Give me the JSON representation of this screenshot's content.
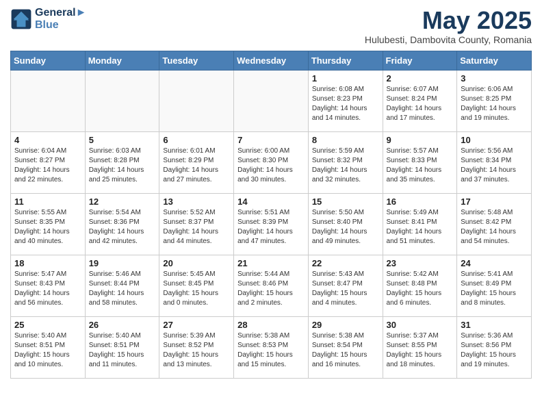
{
  "header": {
    "logo_line1": "General",
    "logo_line2": "Blue",
    "month_title": "May 2025",
    "location": "Hulubesti, Dambovita County, Romania"
  },
  "days_of_week": [
    "Sunday",
    "Monday",
    "Tuesday",
    "Wednesday",
    "Thursday",
    "Friday",
    "Saturday"
  ],
  "weeks": [
    [
      {
        "day": "",
        "info": ""
      },
      {
        "day": "",
        "info": ""
      },
      {
        "day": "",
        "info": ""
      },
      {
        "day": "",
        "info": ""
      },
      {
        "day": "1",
        "info": "Sunrise: 6:08 AM\nSunset: 8:23 PM\nDaylight: 14 hours\nand 14 minutes."
      },
      {
        "day": "2",
        "info": "Sunrise: 6:07 AM\nSunset: 8:24 PM\nDaylight: 14 hours\nand 17 minutes."
      },
      {
        "day": "3",
        "info": "Sunrise: 6:06 AM\nSunset: 8:25 PM\nDaylight: 14 hours\nand 19 minutes."
      }
    ],
    [
      {
        "day": "4",
        "info": "Sunrise: 6:04 AM\nSunset: 8:27 PM\nDaylight: 14 hours\nand 22 minutes."
      },
      {
        "day": "5",
        "info": "Sunrise: 6:03 AM\nSunset: 8:28 PM\nDaylight: 14 hours\nand 25 minutes."
      },
      {
        "day": "6",
        "info": "Sunrise: 6:01 AM\nSunset: 8:29 PM\nDaylight: 14 hours\nand 27 minutes."
      },
      {
        "day": "7",
        "info": "Sunrise: 6:00 AM\nSunset: 8:30 PM\nDaylight: 14 hours\nand 30 minutes."
      },
      {
        "day": "8",
        "info": "Sunrise: 5:59 AM\nSunset: 8:32 PM\nDaylight: 14 hours\nand 32 minutes."
      },
      {
        "day": "9",
        "info": "Sunrise: 5:57 AM\nSunset: 8:33 PM\nDaylight: 14 hours\nand 35 minutes."
      },
      {
        "day": "10",
        "info": "Sunrise: 5:56 AM\nSunset: 8:34 PM\nDaylight: 14 hours\nand 37 minutes."
      }
    ],
    [
      {
        "day": "11",
        "info": "Sunrise: 5:55 AM\nSunset: 8:35 PM\nDaylight: 14 hours\nand 40 minutes."
      },
      {
        "day": "12",
        "info": "Sunrise: 5:54 AM\nSunset: 8:36 PM\nDaylight: 14 hours\nand 42 minutes."
      },
      {
        "day": "13",
        "info": "Sunrise: 5:52 AM\nSunset: 8:37 PM\nDaylight: 14 hours\nand 44 minutes."
      },
      {
        "day": "14",
        "info": "Sunrise: 5:51 AM\nSunset: 8:39 PM\nDaylight: 14 hours\nand 47 minutes."
      },
      {
        "day": "15",
        "info": "Sunrise: 5:50 AM\nSunset: 8:40 PM\nDaylight: 14 hours\nand 49 minutes."
      },
      {
        "day": "16",
        "info": "Sunrise: 5:49 AM\nSunset: 8:41 PM\nDaylight: 14 hours\nand 51 minutes."
      },
      {
        "day": "17",
        "info": "Sunrise: 5:48 AM\nSunset: 8:42 PM\nDaylight: 14 hours\nand 54 minutes."
      }
    ],
    [
      {
        "day": "18",
        "info": "Sunrise: 5:47 AM\nSunset: 8:43 PM\nDaylight: 14 hours\nand 56 minutes."
      },
      {
        "day": "19",
        "info": "Sunrise: 5:46 AM\nSunset: 8:44 PM\nDaylight: 14 hours\nand 58 minutes."
      },
      {
        "day": "20",
        "info": "Sunrise: 5:45 AM\nSunset: 8:45 PM\nDaylight: 15 hours\nand 0 minutes."
      },
      {
        "day": "21",
        "info": "Sunrise: 5:44 AM\nSunset: 8:46 PM\nDaylight: 15 hours\nand 2 minutes."
      },
      {
        "day": "22",
        "info": "Sunrise: 5:43 AM\nSunset: 8:47 PM\nDaylight: 15 hours\nand 4 minutes."
      },
      {
        "day": "23",
        "info": "Sunrise: 5:42 AM\nSunset: 8:48 PM\nDaylight: 15 hours\nand 6 minutes."
      },
      {
        "day": "24",
        "info": "Sunrise: 5:41 AM\nSunset: 8:49 PM\nDaylight: 15 hours\nand 8 minutes."
      }
    ],
    [
      {
        "day": "25",
        "info": "Sunrise: 5:40 AM\nSunset: 8:51 PM\nDaylight: 15 hours\nand 10 minutes."
      },
      {
        "day": "26",
        "info": "Sunrise: 5:40 AM\nSunset: 8:51 PM\nDaylight: 15 hours\nand 11 minutes."
      },
      {
        "day": "27",
        "info": "Sunrise: 5:39 AM\nSunset: 8:52 PM\nDaylight: 15 hours\nand 13 minutes."
      },
      {
        "day": "28",
        "info": "Sunrise: 5:38 AM\nSunset: 8:53 PM\nDaylight: 15 hours\nand 15 minutes."
      },
      {
        "day": "29",
        "info": "Sunrise: 5:38 AM\nSunset: 8:54 PM\nDaylight: 15 hours\nand 16 minutes."
      },
      {
        "day": "30",
        "info": "Sunrise: 5:37 AM\nSunset: 8:55 PM\nDaylight: 15 hours\nand 18 minutes."
      },
      {
        "day": "31",
        "info": "Sunrise: 5:36 AM\nSunset: 8:56 PM\nDaylight: 15 hours\nand 19 minutes."
      }
    ]
  ]
}
